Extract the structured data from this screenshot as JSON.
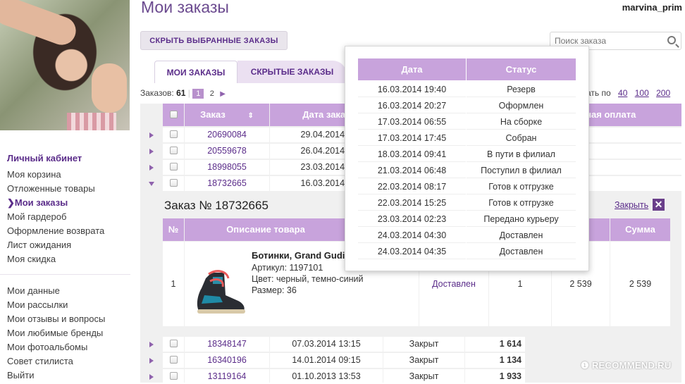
{
  "user": {
    "name": "marvina_prim"
  },
  "page": {
    "title": "Мои заказы"
  },
  "sidebar": {
    "section_title": "Личный кабинет",
    "group1": [
      "Моя корзина",
      "Отложенные товары",
      "Мои заказы",
      "Мой гардероб",
      "Оформление возврата",
      "Лист ожидания",
      "Моя скидка"
    ],
    "active_prefix": "❯",
    "group2": [
      "Мои данные",
      "Мои рассылки",
      "Мои отзывы и вопросы",
      "Мои любимые бренды",
      "Мои фотоальбомы",
      "Совет стилиста",
      "Выйти"
    ]
  },
  "toolbar": {
    "hide_selected": "СКРЫТЬ ВЫБРАННЫЕ ЗАКАЗЫ",
    "search_placeholder": "Поиск заказа"
  },
  "tabs": [
    "МОИ ЗАКАЗЫ",
    "СКРЫТЫЕ ЗАКАЗЫ"
  ],
  "counter": {
    "label": "Заказов:",
    "total": "61",
    "pages": [
      "1",
      "2"
    ]
  },
  "per_page": {
    "label": "ать по",
    "options": [
      "40",
      "100",
      "200"
    ]
  },
  "orders_table": {
    "headers": {
      "order": "Заказ",
      "date": "Дата заказ",
      "payment": "чная оплата"
    },
    "rows": [
      {
        "number": "20690084",
        "date": "29.04.2014 0"
      },
      {
        "number": "20559678",
        "date": "26.04.2014 0"
      },
      {
        "number": "18998055",
        "date": "23.03.2014 0"
      },
      {
        "number": "18732665",
        "date": "16.03.2014 1"
      }
    ],
    "bottom_rows": [
      {
        "number": "18348147",
        "date": "07.03.2014 13:15",
        "status": "Закрыт",
        "sum": "1 614"
      },
      {
        "number": "16340196",
        "date": "14.01.2014 09:15",
        "status": "Закрыт",
        "sum": "1 134"
      },
      {
        "number": "13119164",
        "date": "01.10.2013 13:53",
        "status": "Закрыт",
        "sum": "1 933"
      }
    ]
  },
  "order_detail": {
    "title": "Заказ № 18732665",
    "close_label": "Закрыть",
    "close_icon": "✕",
    "headers": {
      "num": "№",
      "desc": "Описание товара",
      "price": "а",
      "sum": "Сумма"
    },
    "item": {
      "index": "1",
      "name": "Ботинки, Grand Gudi",
      "article": "Артикул:  1197101",
      "color": "Цвет:  черный, темно-синий",
      "size": "Размер:  36",
      "status": "Доставлен",
      "qty": "1",
      "price": "2 539",
      "sum": "2 539"
    }
  },
  "status_popup": {
    "headers": {
      "date": "Дата",
      "status": "Статус"
    },
    "rows": [
      {
        "date": "16.03.2014 19:40",
        "status": "Резерв"
      },
      {
        "date": "16.03.2014 20:27",
        "status": "Оформлен"
      },
      {
        "date": "17.03.2014 06:55",
        "status": "На сборке"
      },
      {
        "date": "17.03.2014 17:45",
        "status": "Собран"
      },
      {
        "date": "18.03.2014 09:41",
        "status": "В пути в филиал"
      },
      {
        "date": "21.03.2014 06:48",
        "status": "Поступил в филиал"
      },
      {
        "date": "22.03.2014 08:17",
        "status": "Готов к отгрузке"
      },
      {
        "date": "22.03.2014 15:25",
        "status": "Готов к отгрузке"
      },
      {
        "date": "23.03.2014 02:23",
        "status": "Передано курьеру"
      },
      {
        "date": "24.03.2014 04:30",
        "status": "Доставлен"
      },
      {
        "date": "24.03.2014 04:35",
        "status": "Доставлен"
      }
    ]
  },
  "watermark": "❶ RECOMMEND.RU"
}
